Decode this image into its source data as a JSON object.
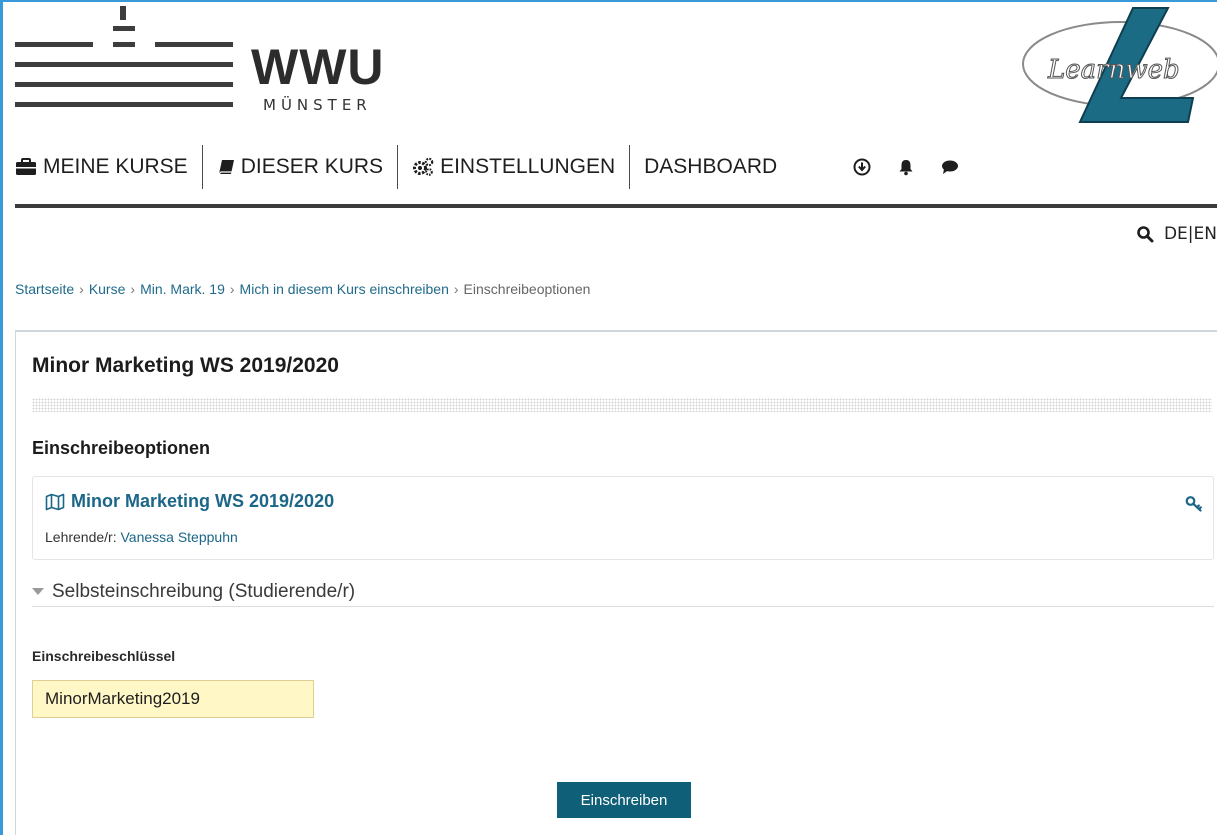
{
  "header": {
    "logo_text": "WWU",
    "logo_sub": "MÜNSTER",
    "learnweb_logo_text": "Learnweb"
  },
  "nav": {
    "items": [
      {
        "label": "MEINE KURSE",
        "icon": "briefcase-icon"
      },
      {
        "label": "DIESER KURS",
        "icon": "book-icon"
      },
      {
        "label": "EINSTELLUNGEN",
        "icon": "gears-icon"
      },
      {
        "label": "DASHBOARD"
      }
    ],
    "icons": [
      "download-circle-icon",
      "bell-icon",
      "chat-bubble-icon"
    ]
  },
  "lang": {
    "de": "DE",
    "sep": "|",
    "en": "EN"
  },
  "breadcrumb": {
    "items": [
      "Startseite",
      "Kurse",
      "Min. Mark. 19",
      "Mich in diesem Kurs einschreiben"
    ],
    "current": "Einschreibeoptionen",
    "separator": "›"
  },
  "main": {
    "course_title": "Minor Marketing WS 2019/2020",
    "section_title": "Einschreibeoptionen",
    "course_box": {
      "link_label": "Minor Marketing WS 2019/2020",
      "teacher_label": "Lehrende/r:",
      "teacher_name": "Vanessa Steppuhn"
    },
    "collapse_label": "Selbsteinschreibung (Studierende/r)",
    "field_label": "Einschreibeschlüssel",
    "field_value": "MinorMarketing2019",
    "submit_label": "Einschreiben"
  },
  "colors": {
    "accent": "#0f5f78",
    "link": "#1c6688",
    "input_bg": "#fff7c6",
    "frame": "#3a9ad9"
  }
}
